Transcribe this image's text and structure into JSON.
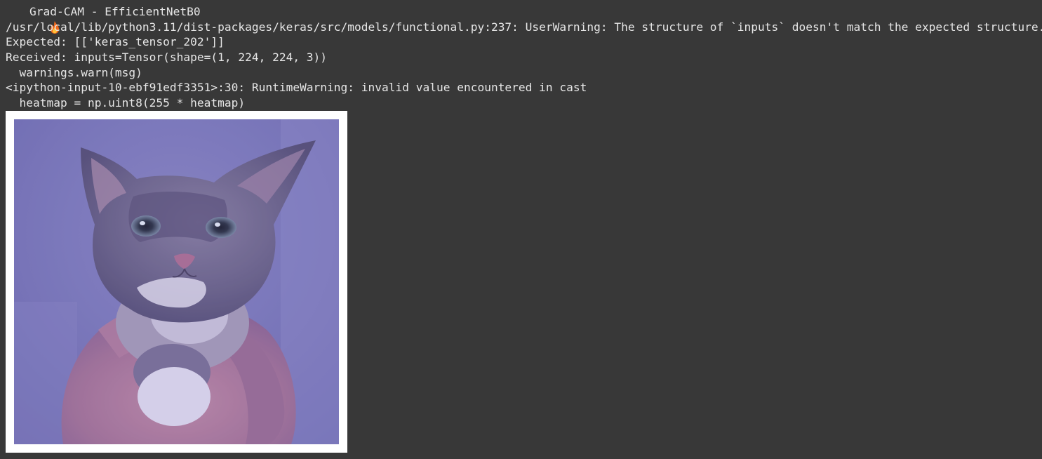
{
  "cell_output": {
    "title_icon": "fire-icon",
    "title": "Grad-CAM - EfficientNetB0",
    "lines": [
      "/usr/local/lib/python3.11/dist-packages/keras/src/models/functional.py:237: UserWarning: The structure of `inputs` doesn't match the expected structure.",
      "Expected: [['keras_tensor_202']]",
      "Received: inputs=Tensor(shape=(1, 224, 224, 3))",
      "  warnings.warn(msg)",
      "<ipython-input-10-ebf91edf3351>:30: RuntimeWarning: invalid value encountered in cast",
      "  heatmap = np.uint8(255 * heatmap)"
    ]
  },
  "colors": {
    "background": "#383838",
    "text": "#e6e6e6",
    "overlay_tint": "#6f6cc0"
  },
  "image": {
    "subject": "kitten-held-in-hand"
  }
}
